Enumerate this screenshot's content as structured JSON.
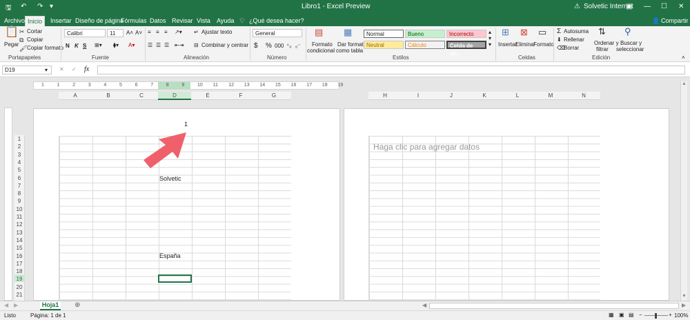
{
  "window": {
    "title": "Libro1 - Excel Preview",
    "user": "Solvetic Internet"
  },
  "tabs": {
    "archivo": "Archivo",
    "inicio": "Inicio",
    "insertar": "Insertar",
    "diseno": "Diseño de página",
    "formulas": "Fórmulas",
    "datos": "Datos",
    "revisar": "Revisar",
    "vista": "Vista",
    "ayuda": "Ayuda",
    "tell_me": "¿Qué desea hacer?",
    "share": "Compartir"
  },
  "ribbon": {
    "clipboard": {
      "paste": "Pegar",
      "cut": "Cortar",
      "copy": "Copiar",
      "format_painter": "Copiar formato",
      "group": "Portapapeles"
    },
    "font": {
      "name": "Calibri",
      "size": "11",
      "bold": "N",
      "italic": "K",
      "underline": "S",
      "group": "Fuente"
    },
    "alignment": {
      "wrap": "Ajustar texto",
      "merge": "Combinar y centrar",
      "group": "Alineación"
    },
    "number": {
      "format": "General",
      "currency": "$",
      "percent": "%",
      "comma": "000",
      "group": "Número"
    },
    "styles": {
      "conditional_1": "Formato",
      "conditional_2": "condicional",
      "table_1": "Dar formato",
      "table_2": "como tabla",
      "normal": "Normal",
      "bueno": "Bueno",
      "incorrecto": "Incorrecto",
      "neutral": "Neutral",
      "calculo": "Cálculo",
      "celda": "Celda de co...",
      "group": "Estilos"
    },
    "cells": {
      "insert": "Insertar",
      "delete": "Eliminar",
      "format": "Formato",
      "group": "Celdas"
    },
    "editing": {
      "autosum": "Autosuma",
      "fill": "Rellenar",
      "clear": "Borrar",
      "sort_1": "Ordenar y",
      "sort_2": "filtrar",
      "find_1": "Buscar y",
      "find_2": "seleccionar",
      "group": "Edición"
    }
  },
  "formula_bar": {
    "name_box": "D19",
    "fx": "fx",
    "cancel": "✕",
    "enter": "✓",
    "value": ""
  },
  "ruler": [
    "1",
    "1",
    "2",
    "3",
    "4",
    "5",
    "6",
    "7",
    "8",
    "9",
    "10",
    "11",
    "12",
    "13",
    "14",
    "15",
    "16",
    "17",
    "18",
    "19"
  ],
  "columns_left": [
    "A",
    "B",
    "C",
    "D",
    "E",
    "F",
    "G"
  ],
  "columns_right": [
    "H",
    "I",
    "J",
    "K",
    "L",
    "M",
    "N"
  ],
  "rows": [
    "1",
    "2",
    "3",
    "4",
    "5",
    "6",
    "7",
    "8",
    "9",
    "10",
    "11",
    "12",
    "13",
    "14",
    "15",
    "16",
    "17",
    "18",
    "19",
    "20",
    "21"
  ],
  "page_number": "1",
  "cells": {
    "d6": "Solvetic",
    "d16": "España"
  },
  "placeholder": "Haga clic para agregar datos",
  "sheet_tab": "Hoja1",
  "status": {
    "ready": "Listo",
    "page": "Página: 1 de 1",
    "zoom": "100%"
  },
  "colors": {
    "accent": "#217346",
    "arrow": "#f0606b"
  }
}
